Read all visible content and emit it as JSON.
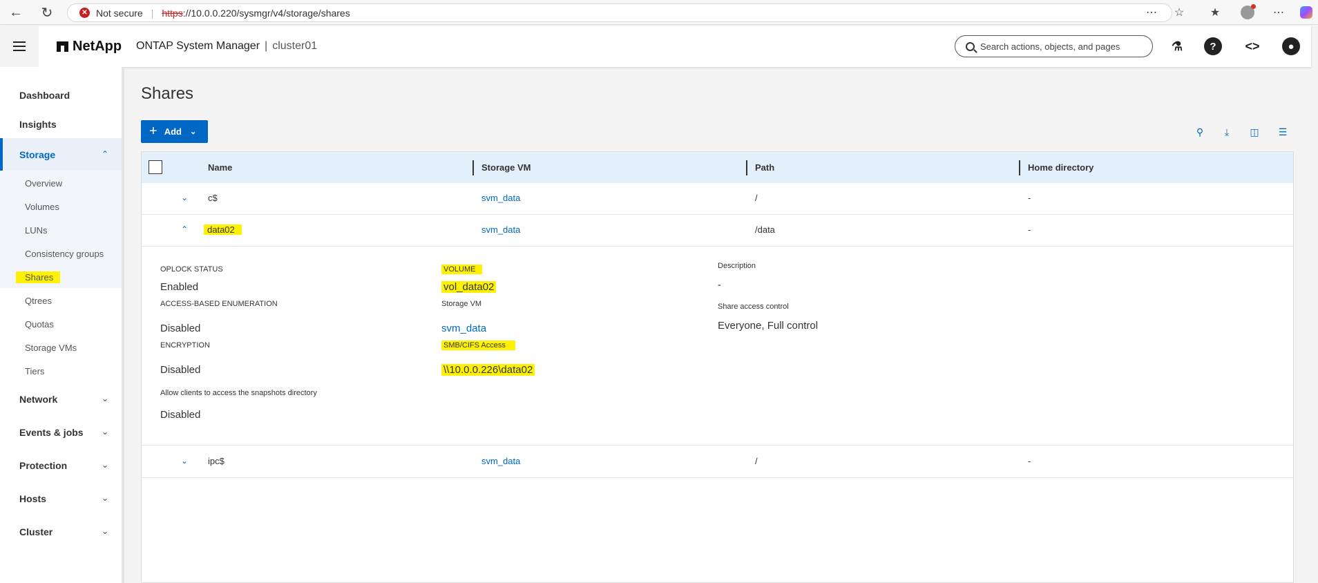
{
  "browser": {
    "security_label": "Not secure",
    "url_scheme": "https",
    "url_rest": "://10.0.0.220/sysmgr/v4/storage/shares"
  },
  "header": {
    "brand": "NetApp",
    "product": "ONTAP System Manager",
    "separator": "|",
    "cluster": "cluster01",
    "search_placeholder": "Search actions, objects, and pages"
  },
  "sidebar": {
    "items": [
      {
        "label": "Dashboard"
      },
      {
        "label": "Insights"
      },
      {
        "label": "Storage"
      },
      {
        "label": "Network"
      },
      {
        "label": "Events & jobs"
      },
      {
        "label": "Protection"
      },
      {
        "label": "Hosts"
      },
      {
        "label": "Cluster"
      }
    ],
    "storage_sub": [
      {
        "label": "Overview"
      },
      {
        "label": "Volumes"
      },
      {
        "label": "LUNs"
      },
      {
        "label": "Consistency groups"
      },
      {
        "label": "Shares"
      },
      {
        "label": "Qtrees"
      },
      {
        "label": "Quotas"
      },
      {
        "label": "Storage VMs"
      },
      {
        "label": "Tiers"
      }
    ]
  },
  "page": {
    "title": "Shares",
    "add_label": "Add"
  },
  "table": {
    "columns": [
      "Name",
      "Storage VM",
      "Path",
      "Home directory"
    ],
    "rows": [
      {
        "name": "c$",
        "svm": "svm_data",
        "path": "/",
        "home": "-"
      },
      {
        "name": "data02",
        "svm": "svm_data",
        "path": "/data",
        "home": "-"
      },
      {
        "name": "ipc$",
        "svm": "svm_data",
        "path": "/",
        "home": "-"
      }
    ]
  },
  "detail": {
    "oplock_label": "OPLOCK STATUS",
    "oplock_value": "Enabled",
    "abe_label": "ACCESS-BASED ENUMERATION",
    "abe_value": "Disabled",
    "encryption_label": "ENCRYPTION",
    "encryption_value": "Disabled",
    "snapshots_label": "Allow clients to access the snapshots directory",
    "snapshots_value": "Disabled",
    "volume_label": "VOLUME",
    "volume_value": "vol_data02",
    "svm_label": "Storage VM",
    "svm_value": "svm_data",
    "smb_label": "SMB/CIFS Access",
    "smb_value": "\\\\10.0.0.226\\data02",
    "description_label": "Description",
    "description_value": "-",
    "acl_label": "Share access control",
    "acl_value": "Everyone, Full control"
  },
  "colors": {
    "accent": "#0067c5",
    "highlight": "#fff200",
    "header_bg": "#e3f0fb"
  }
}
